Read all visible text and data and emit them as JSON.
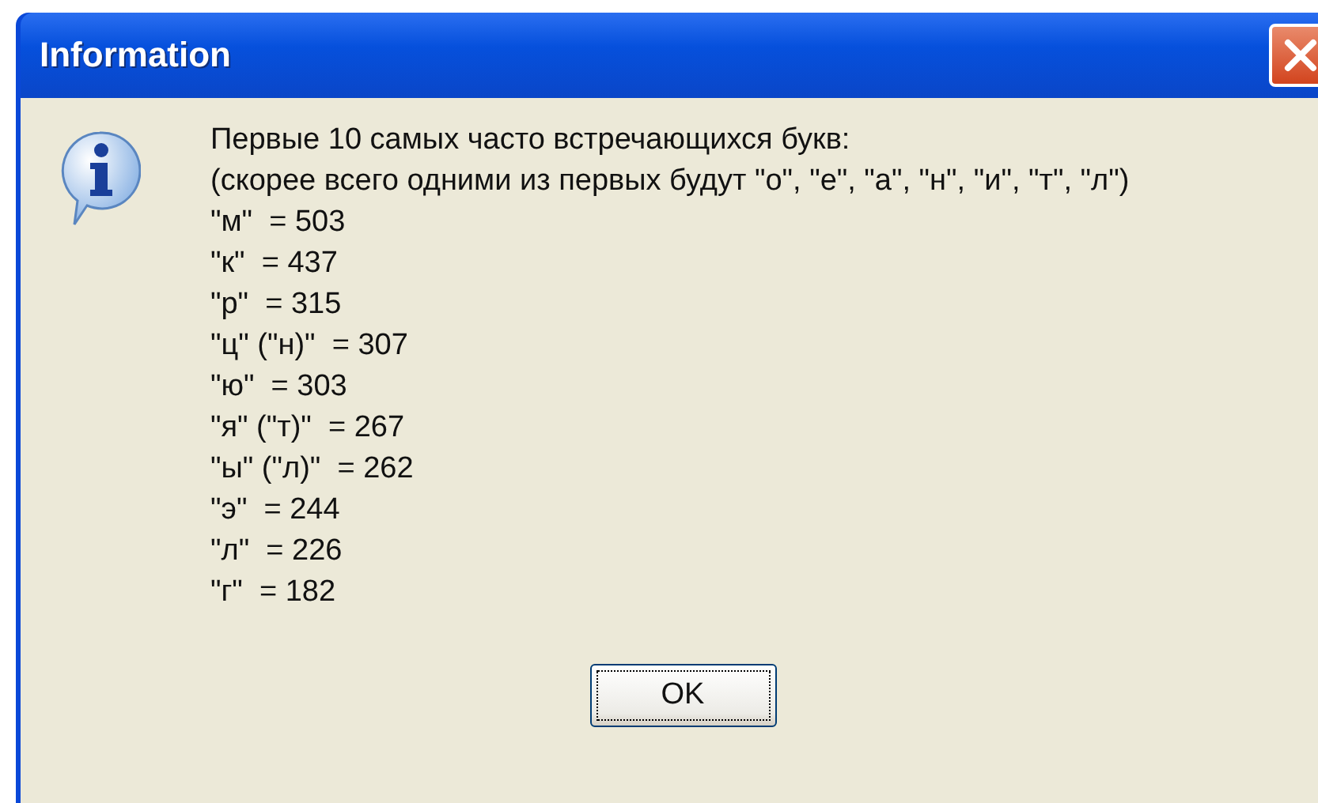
{
  "window": {
    "title": "Information"
  },
  "message": {
    "lines": [
      "Первые 10 самых часто встречающихся букв:",
      "(скорее всего одними из первых будут \"о\", \"е\", \"а\", \"н\", \"и\", \"т\", \"л\")",
      "\"м\"  = 503",
      "\"к\"  = 437",
      "\"р\"  = 315",
      "\"ц\" (\"н)\"  = 307",
      "\"ю\"  = 303",
      "\"я\" (\"т)\"  = 267",
      "\"ы\" (\"л)\"  = 262",
      "\"э\"  = 244",
      "\"л\"  = 226",
      "\"г\"  = 182"
    ]
  },
  "buttons": [
    {
      "label": "OK",
      "focused": true
    }
  ]
}
